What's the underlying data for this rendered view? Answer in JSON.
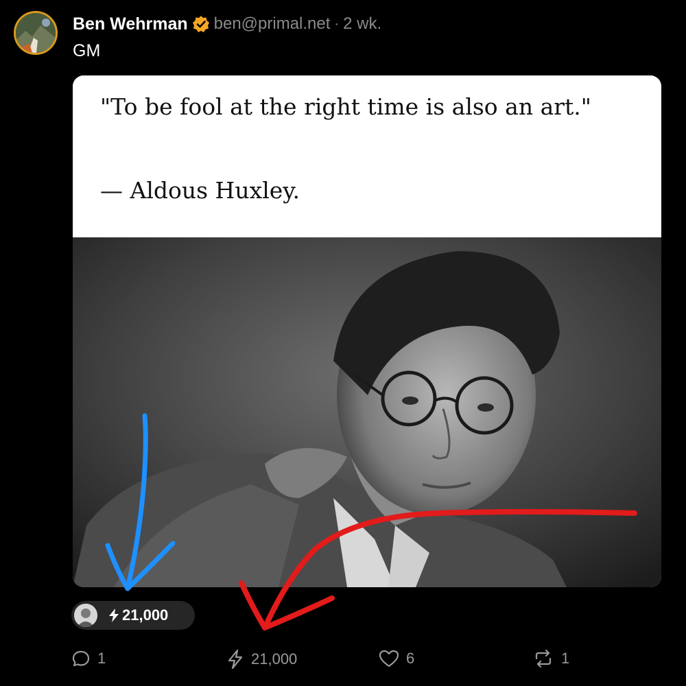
{
  "post": {
    "author_name": "Ben Wehrman",
    "handle": "ben@primal.net",
    "separator": "·",
    "time": "2 wk.",
    "text": "GM",
    "verified_color": "#f5a623"
  },
  "media": {
    "quote": "\"To be fool at the right time is also an art.\"",
    "author": "— Aldous Huxley."
  },
  "zap_pill": {
    "amount": "21,000"
  },
  "actions": {
    "replies": "1",
    "zaps": "21,000",
    "likes": "6",
    "reposts": "1"
  },
  "colors": {
    "background": "#000000",
    "muted": "#9a9a9a",
    "annotation_blue": "#1e90ff",
    "annotation_red": "#e21b1b"
  }
}
